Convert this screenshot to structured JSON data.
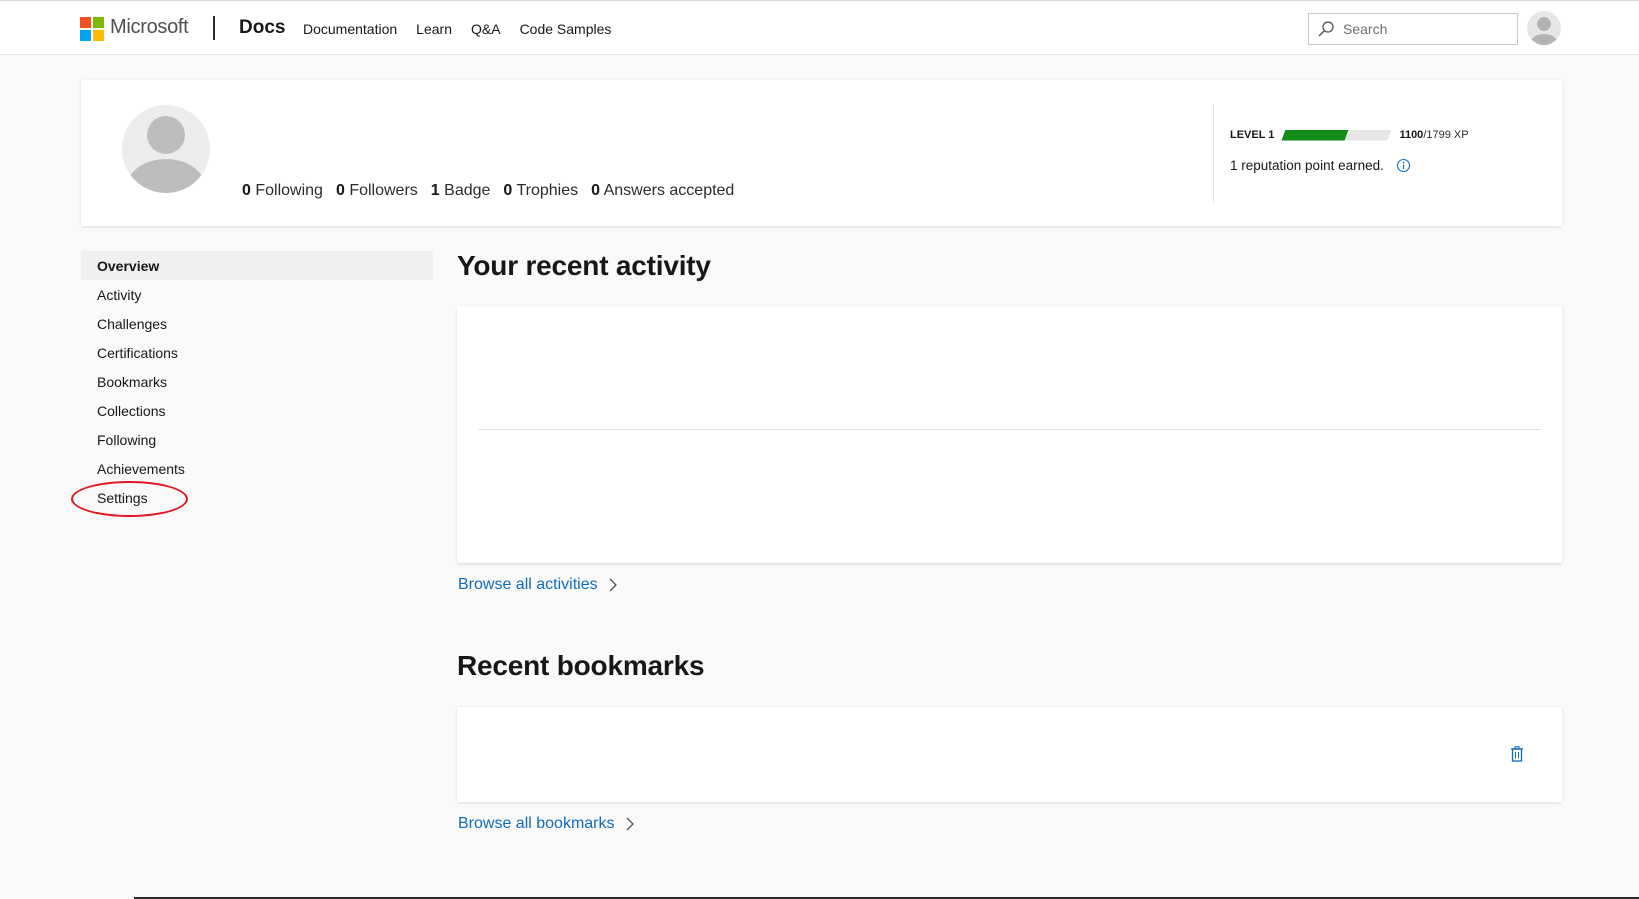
{
  "header": {
    "brand": "Microsoft",
    "product": "Docs",
    "nav": [
      "Documentation",
      "Learn",
      "Q&A",
      "Code Samples"
    ],
    "search_placeholder": "Search",
    "logo_colors": [
      "#f25022",
      "#7fba00",
      "#00a4ef",
      "#ffb900"
    ]
  },
  "profile": {
    "stats": [
      {
        "count": "0",
        "label": "Following"
      },
      {
        "count": "0",
        "label": "Followers"
      },
      {
        "count": "1",
        "label": "Badge"
      },
      {
        "count": "0",
        "label": "Trophies"
      },
      {
        "count": "0",
        "label": "Answers accepted"
      }
    ],
    "level": "LEVEL 1",
    "xp_current": "1100",
    "xp_total": "/1799 XP",
    "xp_progress": 0.61,
    "reputation": "1 reputation point earned."
  },
  "sidebar": {
    "items": [
      "Overview",
      "Activity",
      "Challenges",
      "Certifications",
      "Bookmarks",
      "Collections",
      "Following",
      "Achievements",
      "Settings"
    ],
    "active": "Overview"
  },
  "main": {
    "activity_title": "Your recent activity",
    "browse_activities": "Browse all activities",
    "bookmarks_title": "Recent bookmarks",
    "browse_bookmarks": "Browse all bookmarks"
  },
  "colors": {
    "accent_link": "#0f6cbd",
    "xp_fill": "#128b17",
    "highlight_ring": "#e2141d"
  }
}
